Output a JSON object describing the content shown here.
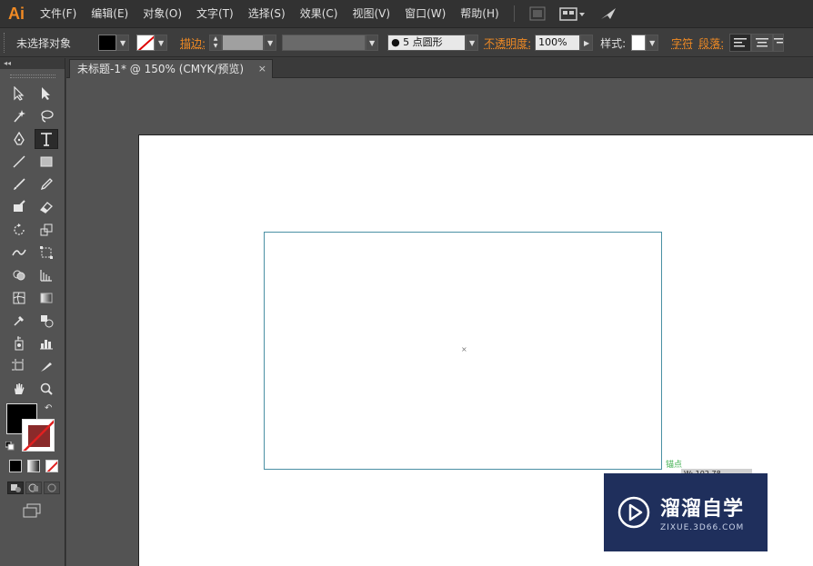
{
  "app": {
    "logo": "Ai",
    "accent_color": "#f08a24"
  },
  "menu": {
    "items": [
      {
        "label": "文件(F)"
      },
      {
        "label": "编辑(E)"
      },
      {
        "label": "对象(O)"
      },
      {
        "label": "文字(T)"
      },
      {
        "label": "选择(S)"
      },
      {
        "label": "效果(C)"
      },
      {
        "label": "视图(V)"
      },
      {
        "label": "窗口(W)"
      },
      {
        "label": "帮助(H)"
      }
    ],
    "icons": [
      "bridge-icon",
      "workspace-layout-icon",
      "sync-icon"
    ]
  },
  "control_bar": {
    "selection_status": "未选择对象",
    "stroke_label": "描边:",
    "brush_value": "5 点圆形",
    "opacity_label": "不透明度:",
    "opacity_value": "100%",
    "style_label": "样式:",
    "character_label": "字符",
    "paragraph_label": "段落:"
  },
  "toolbox": {
    "collapse_label": "◂◂",
    "selected_tool": "type-tool",
    "fill_color": "#000000",
    "stroke_color": "none"
  },
  "document": {
    "tab_title": "未标题-1* @ 150% (CMYK/预览)",
    "close_glyph": "×"
  },
  "canvas": {
    "anchor_label": "锚点",
    "tooltip": "W: 102.78",
    "center_marker": "×"
  },
  "watermark": {
    "title": "溜溜自学",
    "subtitle": "ZIXUE.3D66.COM"
  }
}
